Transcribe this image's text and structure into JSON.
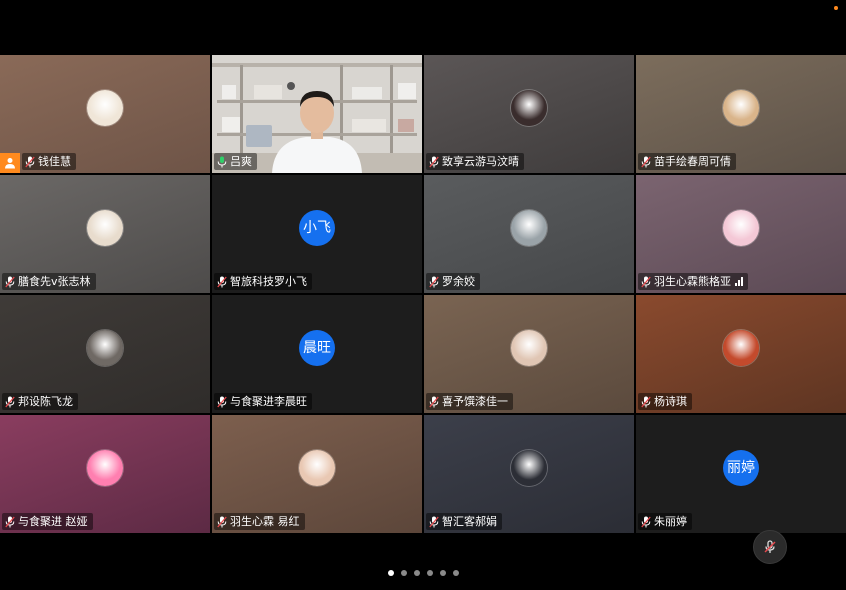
{
  "participants": [
    {
      "name": "钱佳慧",
      "avatar_type": "image",
      "avatar_color": "#f0e6d8",
      "bg": [
        "#8a6a58",
        "#6e5447"
      ],
      "host": true
    },
    {
      "name": "吕爽",
      "avatar_type": "video",
      "active": true
    },
    {
      "name": "致享云游马汶晴",
      "avatar_type": "image",
      "avatar_color": "#3a2d2d",
      "bg": [
        "#5b5656",
        "#3f3c3c"
      ]
    },
    {
      "name": "苗手绘春周可倩",
      "avatar_type": "image",
      "avatar_color": "#d9b48a",
      "bg": [
        "#7c6d5c",
        "#5d5248"
      ]
    },
    {
      "name": "膳食先v张志林",
      "avatar_type": "image",
      "avatar_color": "#e8dccd",
      "bg": [
        "#6b6866",
        "#4d4b4a"
      ]
    },
    {
      "name": "智旅科技罗小飞",
      "avatar_type": "text",
      "avatar_text": "小飞",
      "bg": [
        "#1d1d1d",
        "#1d1d1d"
      ]
    },
    {
      "name": "罗余姣",
      "avatar_type": "image",
      "avatar_color": "#9aa3a8",
      "bg": [
        "#5a5c5e",
        "#454749"
      ]
    },
    {
      "name": "羽生心霖熊格亚",
      "avatar_type": "image",
      "avatar_color": "#f4c8d6",
      "bg": [
        "#7b6470",
        "#5c4a55"
      ],
      "signal": true
    },
    {
      "name": "邦设陈飞龙",
      "avatar_type": "image",
      "avatar_color": "#6f6964",
      "bg": [
        "#3f3b38",
        "#2f2c2a"
      ]
    },
    {
      "name": "与食聚进李晨旺",
      "avatar_type": "text",
      "avatar_text": "晨旺",
      "bg": [
        "#1d1d1d",
        "#1d1d1d"
      ]
    },
    {
      "name": "喜予馔漆佳一",
      "avatar_type": "image",
      "avatar_color": "#e0c6b4",
      "bg": [
        "#7a6452",
        "#5b4a3d"
      ]
    },
    {
      "name": "杨诗琪",
      "avatar_type": "image",
      "avatar_color": "#c44a2c",
      "bg": [
        "#8a4a2e",
        "#5e3522"
      ]
    },
    {
      "name": "与食聚进 赵娅",
      "avatar_type": "image",
      "avatar_color": "#ff7fb0",
      "bg": [
        "#8a3d5f",
        "#5c2a44"
      ]
    },
    {
      "name": "羽生心霖 易红",
      "avatar_type": "image",
      "avatar_color": "#e9c8b3",
      "bg": [
        "#7d5f4e",
        "#5c463a"
      ]
    },
    {
      "name": "智汇客郝娟",
      "avatar_type": "image",
      "avatar_color": "#2c2e36",
      "bg": [
        "#3c3f4a",
        "#2b2d35"
      ]
    },
    {
      "name": "朱丽婷",
      "avatar_type": "text",
      "avatar_text": "丽婷",
      "bg": [
        "#1d1d1d",
        "#1d1d1d"
      ]
    }
  ],
  "pager": {
    "count": 6,
    "active": 0
  },
  "colors": {
    "accent": "#1570ef",
    "active_border": "#2fd06a",
    "host": "#ff8a1e"
  },
  "icons": {
    "mute": "mic-off-icon",
    "mic": "mic-muted-icon",
    "host": "person-icon"
  }
}
